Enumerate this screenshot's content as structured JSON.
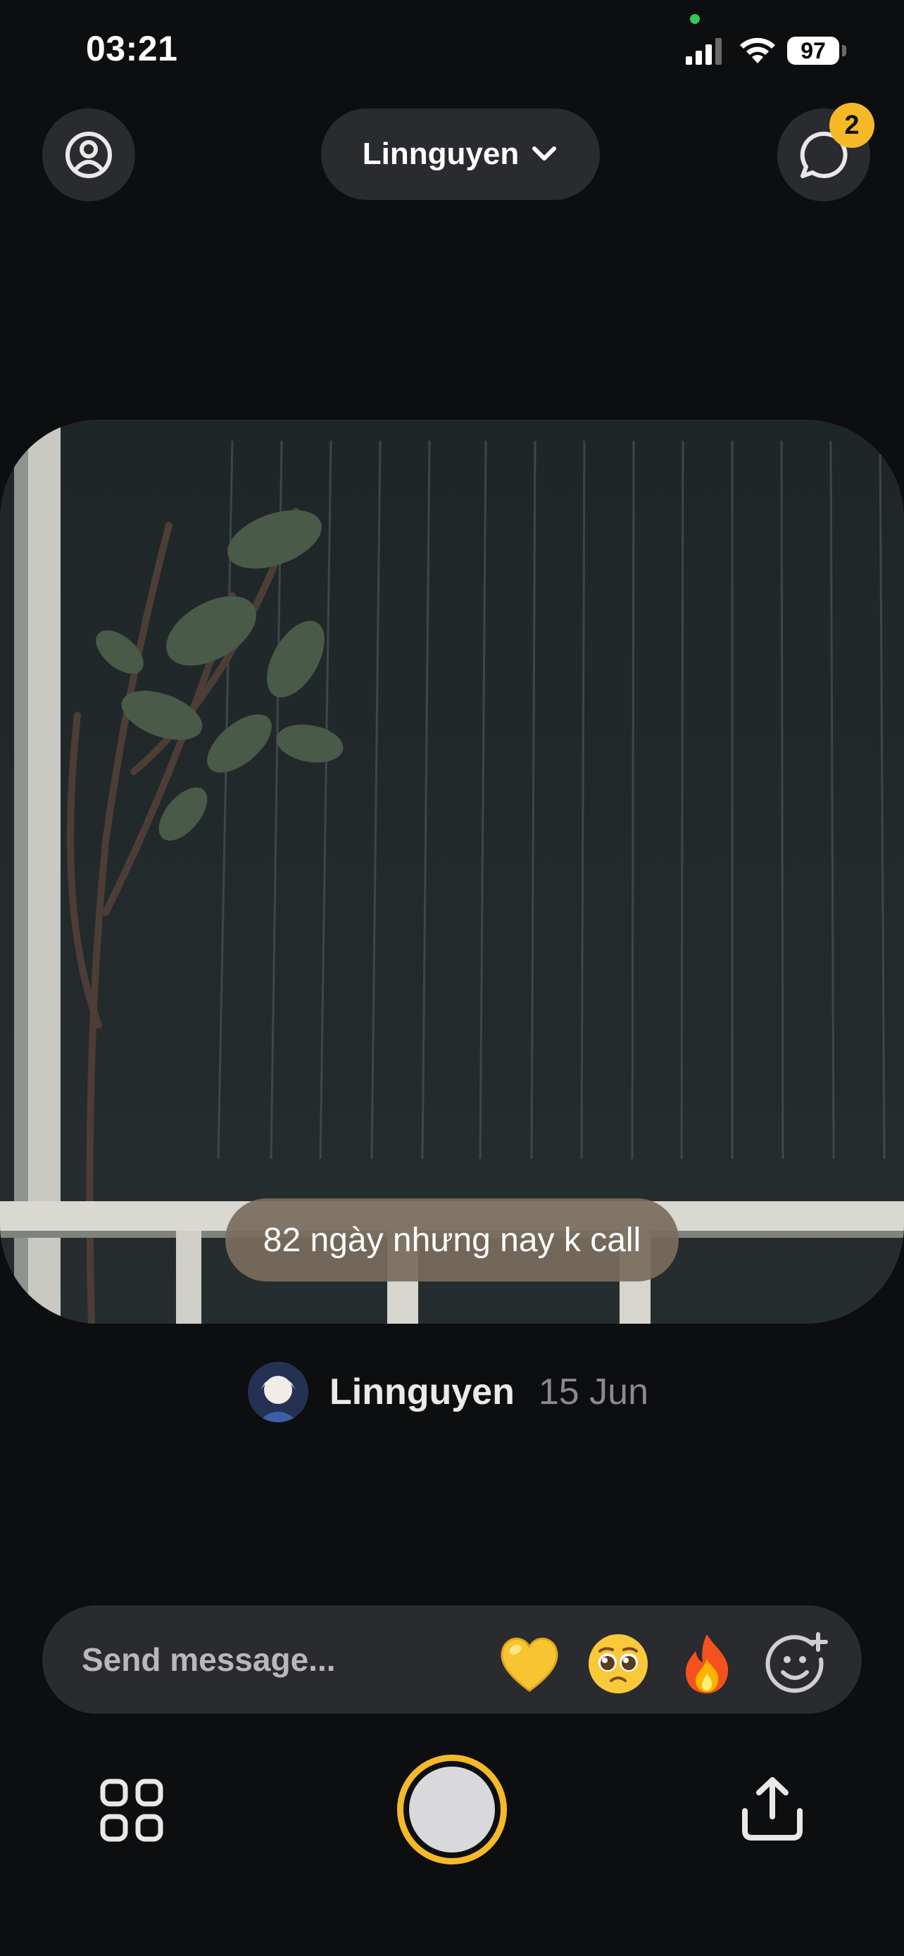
{
  "status_bar": {
    "time": "03:21",
    "battery_level": "97",
    "icons": [
      "signal-icon",
      "wifi-icon",
      "battery-icon"
    ]
  },
  "header": {
    "profile_icon": "person-circle-icon",
    "friend_selector": "Linnguyen",
    "chevron_icon": "chevron-down-icon",
    "chat_icon": "chat-bubble-icon",
    "unread_count": "2"
  },
  "post": {
    "caption": "82 ngày nhưng nay k call",
    "author": "Linnguyen",
    "date": "15 Jun"
  },
  "composer": {
    "placeholder": "Send message...",
    "reactions": [
      "💛",
      "🥺",
      "🔥"
    ],
    "add_reaction_icon": "smiley-plus-icon"
  },
  "bottom_bar": {
    "grid_icon": "grid-icon",
    "shutter_icon": "shutter-button",
    "share_icon": "share-icon"
  },
  "colors": {
    "background": "#0d0e10",
    "surface": "#2a2b2e",
    "accent": "#f5b927",
    "caption_bg": "#786c5c"
  }
}
